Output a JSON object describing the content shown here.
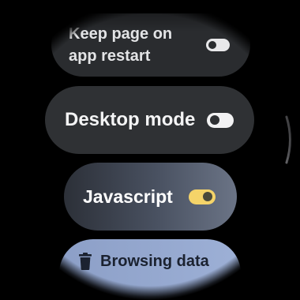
{
  "settings": {
    "items": [
      {
        "label_line1": "Keep page on",
        "label_line2": "app restart",
        "toggle": "off"
      },
      {
        "label": "Desktop mode",
        "toggle": "off"
      },
      {
        "label": "Javascript",
        "toggle": "on"
      },
      {
        "label": "Browsing data",
        "icon": "trash-icon"
      }
    ]
  },
  "colors": {
    "toggle_on": "#f5d469",
    "toggle_off": "#f2f2f3",
    "accent_chip": "#9db0d6"
  }
}
